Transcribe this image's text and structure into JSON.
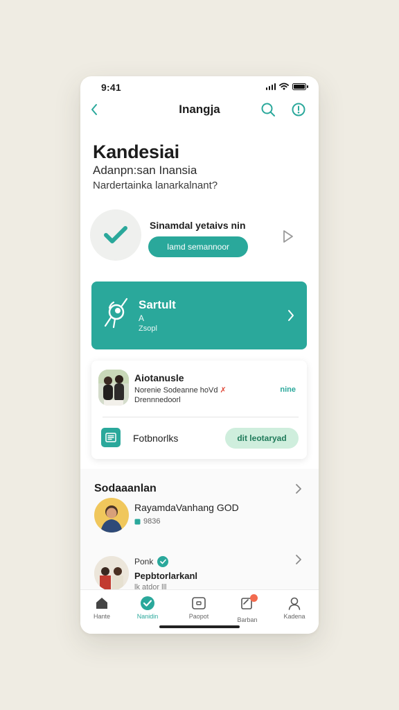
{
  "status_bar": {
    "time": "9:41"
  },
  "nav": {
    "title": "Inangja"
  },
  "header": {
    "title": "Kandesiai",
    "subtitle_line1": "Adanpn:san Inansia",
    "subtitle_line2": "Nardertainka lanarkalnant?"
  },
  "verify": {
    "title": "Sinamdal yetaivs nin",
    "button_label": "Iamd semannoor"
  },
  "banner": {
    "title": "Sartult",
    "line1": "A",
    "line2": "Zsopl"
  },
  "card": {
    "name": "Aiotanusle",
    "line1": "Norenie Sodeanne hoVd",
    "line1_mark": "✗",
    "line2": "Drennnedoorl",
    "link": "nine",
    "row2_label": "Fotbnorlks",
    "row2_button": "dit leotaryad"
  },
  "section": {
    "title": "Sodaaanlan",
    "item1": {
      "title": "RayamdaVanhang GOD",
      "meta": "9836"
    },
    "item2": {
      "label": "Ponk",
      "title": "Pepbtorlarkanl",
      "meta": "lk atdor lll"
    }
  },
  "tabs": [
    {
      "label": "Hante",
      "icon": "home-icon"
    },
    {
      "label": "Nanidin",
      "icon": "check-badge-icon"
    },
    {
      "label": "Paopot",
      "icon": "camera-icon"
    },
    {
      "label": "Barban",
      "icon": "notes-icon"
    },
    {
      "label": "Kadena",
      "icon": "profile-icon"
    }
  ],
  "colors": {
    "accent": "#2aa89b",
    "pill_bg": "#cfeedd",
    "notif": "#f26b4f",
    "background": "#efece3"
  }
}
